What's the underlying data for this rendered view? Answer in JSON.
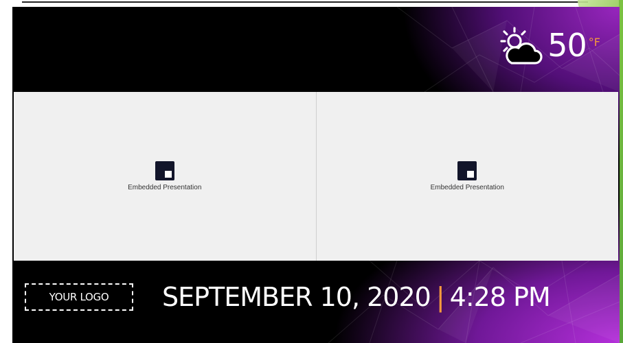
{
  "weather": {
    "icon": "partly-cloudy-sun-icon",
    "temperature": "50",
    "unit": "°F"
  },
  "embeds": [
    {
      "label": "Embedded Presentation",
      "icon": "presentation-embed-icon"
    },
    {
      "label": "Embedded Presentation",
      "icon": "presentation-embed-icon"
    }
  ],
  "footer": {
    "logo_text": "YOUR LOGO",
    "date": "SEPTEMBER 10, 2020",
    "separator": "|",
    "time": "4:28 PM"
  },
  "colors": {
    "accent": "#f39a3d",
    "purple": "#a020c8",
    "background": "#000000"
  }
}
